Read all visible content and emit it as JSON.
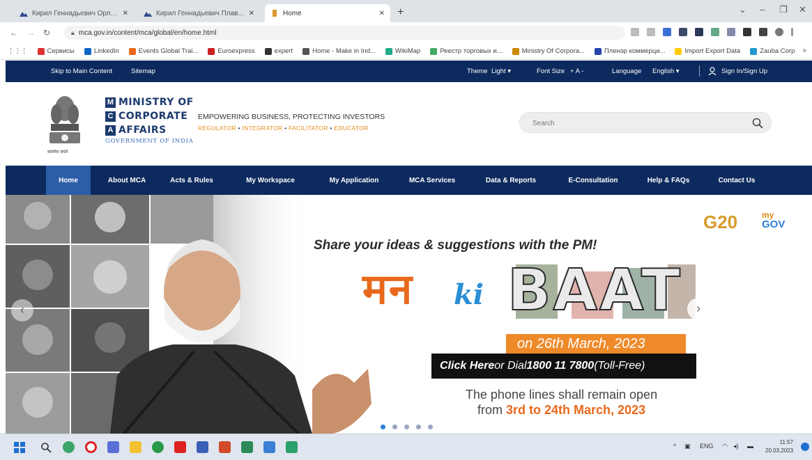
{
  "browser": {
    "tabs": [
      {
        "title": "Кирил Геннадьевич Орло...",
        "active": false,
        "icon": "mountain-icon"
      },
      {
        "title": "Кирил Геннадьевич Плав...",
        "active": false,
        "icon": "mountain-icon"
      },
      {
        "title": "Home",
        "active": true,
        "icon": "emblem-icon"
      }
    ],
    "new_tab": "+",
    "url": "mca.gov.in/content/mca/global/en/home.html",
    "bookmarks": [
      {
        "label": "Сервисы",
        "color": "#d33"
      },
      {
        "label": "LinkedIn",
        "color": "#0a66c2"
      },
      {
        "label": "Events Global Trai...",
        "color": "#e8691b"
      },
      {
        "label": "Euroexpress",
        "color": "#c22"
      },
      {
        "label": "expert",
        "color": "#333"
      },
      {
        "label": "Home - Make in Ind...",
        "color": "#555"
      },
      {
        "label": "WikiMap",
        "color": "#2a8"
      },
      {
        "label": "Реестр торговых и...",
        "color": "#4a6"
      },
      {
        "label": "Ministry Of Corpora...",
        "color": "#c80"
      },
      {
        "label": "Пленэр коммерци...",
        "color": "#24a"
      },
      {
        "label": "Import Export Data",
        "color": "#fc0"
      },
      {
        "label": "Zauba Corp",
        "color": "#29c"
      }
    ]
  },
  "site": {
    "topbar": {
      "skip": "Skip to Main Content",
      "sitemap": "Sitemap",
      "theme_label": "Theme",
      "theme_value": "Light ▾",
      "fontsize_label": "Font Size",
      "fontsize_controls": "+   A   -",
      "language_label": "Language",
      "language_value": "English ▾",
      "signin": "Sign In/Sign Up"
    },
    "logo": {
      "line1": "MINISTRY OF",
      "line2": "CORPORATE",
      "line3": "AFFAIRS",
      "letters": [
        "M",
        "C",
        "A"
      ],
      "gov": "GOVERNMENT OF INDIA",
      "emblem_caption": "सत्यमेव जयते"
    },
    "tagline": "EMPOWERING BUSINESS, PROTECTING INVESTORS",
    "roles": [
      "REGULATOR",
      "INTEGRATOR",
      "FACILITATOR",
      "EDUCATOR"
    ],
    "search": {
      "placeholder": "Search"
    },
    "nav": [
      {
        "label": "Home",
        "active": true
      },
      {
        "label": "About MCA"
      },
      {
        "label": "Acts & Rules"
      },
      {
        "label": "My Workspace"
      },
      {
        "label": "My Application"
      },
      {
        "label": "MCA Services"
      },
      {
        "label": "Data & Reports"
      },
      {
        "label": "E-Consultation"
      },
      {
        "label": "Help & FAQs"
      },
      {
        "label": "Contact Us"
      }
    ],
    "banner": {
      "heading": "Share your ideas & suggestions with the PM!",
      "mann": "मन",
      "ki": "ki",
      "baat": "BAAT",
      "date": "on 26th March, 2023",
      "cta_bold": "Click Here",
      "cta_mid": " or Dial ",
      "cta_phone": "1800 11 7800",
      "cta_tail": " (Toll-Free)",
      "note_line1": "The phone lines shall remain open",
      "note_from": "from ",
      "note_range": "3rd to 24th March, 2023",
      "g20": "G20",
      "mygov_my": "my",
      "mygov_gov": "GOV",
      "slides": 5,
      "active_slide": 0
    }
  },
  "taskbar": {
    "tray_lang": "ENG",
    "time": "11:57",
    "date": "20.03.2023"
  }
}
